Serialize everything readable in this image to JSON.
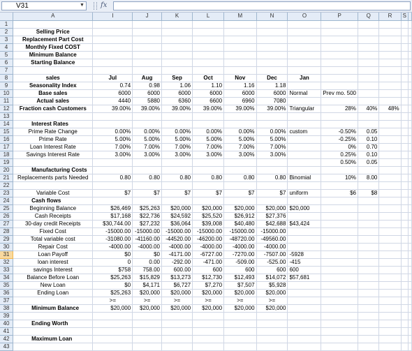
{
  "name_box": "V31",
  "formula": "",
  "columns": [
    "A",
    "I",
    "J",
    "K",
    "L",
    "M",
    "N",
    "O",
    "P",
    "Q",
    "R",
    "S"
  ],
  "selected_row": 31,
  "rows": [
    {
      "n": 1,
      "cells": [
        "",
        "",
        "",
        "",
        "",
        "",
        "",
        "",
        "",
        "",
        "",
        ""
      ]
    },
    {
      "n": 2,
      "cells": [
        "Selling Price",
        "",
        "",
        "",
        "",
        "",
        "",
        "",
        "",
        "",
        "",
        ""
      ]
    },
    {
      "n": 3,
      "cells": [
        "Replacement Part Cost",
        "",
        "",
        "",
        "",
        "",
        "",
        "",
        "",
        "",
        "",
        ""
      ]
    },
    {
      "n": 4,
      "cells": [
        "Monthly Fixed COST",
        "",
        "",
        "",
        "",
        "",
        "",
        "",
        "",
        "",
        "",
        ""
      ]
    },
    {
      "n": 5,
      "cells": [
        "Minimum Balance",
        "",
        "",
        "",
        "",
        "",
        "",
        "",
        "",
        "",
        "",
        ""
      ]
    },
    {
      "n": 6,
      "cells": [
        "Starting Balance",
        "",
        "",
        "",
        "",
        "",
        "",
        "",
        "",
        "",
        "",
        ""
      ]
    },
    {
      "n": 7,
      "cells": [
        "",
        "",
        "",
        "",
        "",
        "",
        "",
        "",
        "",
        "",
        "",
        ""
      ]
    },
    {
      "n": 8,
      "cells": [
        "sales",
        "Jul",
        "Aug",
        "Sep",
        "Oct",
        "Nov",
        "Dec",
        "Jan",
        "",
        "",
        "",
        ""
      ]
    },
    {
      "n": 9,
      "cells": [
        "Seasonality Index",
        "0.74",
        "0.98",
        "1.06",
        "1.10",
        "1.16",
        "1.18",
        "",
        "",
        "",
        "",
        ""
      ]
    },
    {
      "n": 10,
      "cells": [
        "Base sales",
        "6000",
        "6000",
        "6000",
        "6000",
        "6000",
        "6000",
        "Normal",
        "Prev mo. 500",
        "",
        "",
        ""
      ]
    },
    {
      "n": 11,
      "cells": [
        "Actual sales",
        "4440",
        "5880",
        "6360",
        "6600",
        "6960",
        "7080",
        "",
        "",
        "",
        "",
        ""
      ]
    },
    {
      "n": 12,
      "cells": [
        "Fraction cash Customers",
        "39.00%",
        "39.00%",
        "39.00%",
        "39.00%",
        "39.00%",
        "39.00%",
        "Triangular",
        "28%",
        "40%",
        "48%",
        ""
      ]
    },
    {
      "n": 13,
      "cells": [
        "",
        "",
        "",
        "",
        "",
        "",
        "",
        "",
        "",
        "",
        "",
        ""
      ]
    },
    {
      "n": 14,
      "cells": [
        "Interest Rates",
        "",
        "",
        "",
        "",
        "",
        "",
        "",
        "",
        "",
        "",
        ""
      ]
    },
    {
      "n": 15,
      "cells": [
        "Prime Rate Change",
        "0.00%",
        "0.00%",
        "0.00%",
        "0.00%",
        "0.00%",
        "0.00%",
        "custom",
        "-0.50%",
        "0.05",
        "",
        ""
      ]
    },
    {
      "n": 16,
      "cells": [
        "Prime Rate",
        "5.00%",
        "5.00%",
        "5.00%",
        "5.00%",
        "5.00%",
        "5.00%",
        "",
        "-0.25%",
        "0.10",
        "",
        ""
      ]
    },
    {
      "n": 17,
      "cells": [
        "Loan Interest Rate",
        "7.00%",
        "7.00%",
        "7.00%",
        "7.00%",
        "7.00%",
        "7.00%",
        "",
        "0%",
        "0.70",
        "",
        ""
      ]
    },
    {
      "n": 18,
      "cells": [
        "Savings Interest Rate",
        "3.00%",
        "3.00%",
        "3.00%",
        "3.00%",
        "3.00%",
        "3.00%",
        "",
        "0.25%",
        "0.10",
        "",
        ""
      ]
    },
    {
      "n": 19,
      "cells": [
        "",
        "",
        "",
        "",
        "",
        "",
        "",
        "",
        "0.50%",
        "0.05",
        "",
        ""
      ]
    },
    {
      "n": 20,
      "cells": [
        "Manufacturing Costs",
        "",
        "",
        "",
        "",
        "",
        "",
        "",
        "",
        "",
        "",
        ""
      ]
    },
    {
      "n": 21,
      "cells": [
        "Replacements parts Needed",
        "0.80",
        "0.80",
        "0.80",
        "0.80",
        "0.80",
        "0.80",
        "Binomial",
        "10%",
        "8.00",
        "",
        ""
      ]
    },
    {
      "n": 22,
      "cells": [
        "",
        "",
        "",
        "",
        "",
        "",
        "",
        "",
        "",
        "",
        "",
        ""
      ]
    },
    {
      "n": 23,
      "cells": [
        "Variable Cost",
        "$7",
        "$7",
        "$7",
        "$7",
        "$7",
        "$7",
        "uniform",
        "$6",
        "$8",
        "",
        ""
      ]
    },
    {
      "n": 24,
      "cells": [
        "Cash flows",
        "",
        "",
        "",
        "",
        "",
        "",
        "",
        "",
        "",
        "",
        ""
      ]
    },
    {
      "n": 25,
      "cells": [
        "Beginning Balance",
        "$26,469",
        "$25,263",
        "$20,000",
        "$20,000",
        "$20,000",
        "$20,000",
        "$20,000",
        "",
        "",
        "",
        ""
      ]
    },
    {
      "n": 26,
      "cells": [
        "Cash Receipts",
        "$17,168",
        "$22,736",
        "$24,592",
        "$25,520",
        "$26,912",
        "$27,376",
        "",
        "",
        "",
        "",
        ""
      ]
    },
    {
      "n": 27,
      "cells": [
        "30-day credit Receipts",
        "$30,744.00",
        "$27,232",
        "$36,064",
        "$39,008",
        "$40,480",
        "$42,688",
        "$43,424",
        "",
        "",
        "",
        ""
      ]
    },
    {
      "n": 28,
      "cells": [
        "Fixed Cost",
        "-15000.00",
        "-15000.00",
        "-15000.00",
        "-15000.00",
        "-15000.00",
        "-15000.00",
        "",
        "",
        "",
        "",
        ""
      ]
    },
    {
      "n": 29,
      "cells": [
        "Total variable cost",
        "-31080.00",
        "-41160.00",
        "-44520.00",
        "-46200.00",
        "-48720.00",
        "-49560.00",
        "",
        "",
        "",
        "",
        ""
      ]
    },
    {
      "n": 30,
      "cells": [
        "Repair Cost",
        "-4000.00",
        "-4000.00",
        "-4000.00",
        "-4000.00",
        "-4000.00",
        "-4000.00",
        "",
        "",
        "",
        "",
        ""
      ]
    },
    {
      "n": 31,
      "cells": [
        "Loan Payoff",
        "$0",
        "$0",
        "-4171.00",
        "-6727.00",
        "-7270.00",
        "-7507.00",
        "-5928",
        "",
        "",
        "",
        ""
      ]
    },
    {
      "n": 32,
      "cells": [
        "loan interest",
        "0",
        "0.00",
        "-292.00",
        "-471.00",
        "-509.00",
        "-525.00",
        "-415",
        "",
        "",
        "",
        ""
      ]
    },
    {
      "n": 33,
      "cells": [
        "savings Interest",
        "$758",
        "758.00",
        "600.00",
        "600",
        "600",
        "600",
        "600",
        "",
        "",
        "",
        ""
      ]
    },
    {
      "n": 34,
      "cells": [
        "Balance Before Loan",
        "$25,263",
        "$15,829",
        "$13,273",
        "$12,730",
        "$12,493",
        "$14,072",
        "$57,681",
        "",
        "",
        "",
        ""
      ]
    },
    {
      "n": 35,
      "cells": [
        "New Loan",
        "$0",
        "$4,171",
        "$6,727",
        "$7,270",
        "$7,507",
        "$5,928",
        "",
        "",
        "",
        "",
        ""
      ]
    },
    {
      "n": 36,
      "cells": [
        "Ending Loan",
        "$25,263",
        "$20,000",
        "$20,000",
        "$20,000",
        "$20,000",
        "$20,000",
        "",
        "",
        "",
        "",
        ""
      ]
    },
    {
      "n": 37,
      "cells": [
        "",
        ">=",
        ">=",
        ">=",
        ">=",
        ">=",
        ">=",
        "",
        "",
        "",
        "",
        ""
      ]
    },
    {
      "n": 38,
      "cells": [
        "Minimum Balance",
        "$20,000",
        "$20,000",
        "$20,000",
        "$20,000",
        "$20,000",
        "$20,000",
        "",
        "",
        "",
        "",
        ""
      ]
    },
    {
      "n": 39,
      "cells": [
        "",
        "",
        "",
        "",
        "",
        "",
        "",
        "",
        "",
        "",
        "",
        ""
      ]
    },
    {
      "n": 40,
      "cells": [
        "Ending Worth",
        "",
        "",
        "",
        "",
        "",
        "",
        "",
        "",
        "",
        "",
        ""
      ]
    },
    {
      "n": 41,
      "cells": [
        "",
        "",
        "",
        "",
        "",
        "",
        "",
        "",
        "",
        "",
        "",
        ""
      ]
    },
    {
      "n": 42,
      "cells": [
        "Maximum Loan",
        "",
        "",
        "",
        "",
        "",
        "",
        "",
        "",
        "",
        "",
        ""
      ]
    },
    {
      "n": 43,
      "cells": [
        "",
        "",
        "",
        "",
        "",
        "",
        "",
        "",
        "",
        "",
        "",
        ""
      ]
    }
  ]
}
